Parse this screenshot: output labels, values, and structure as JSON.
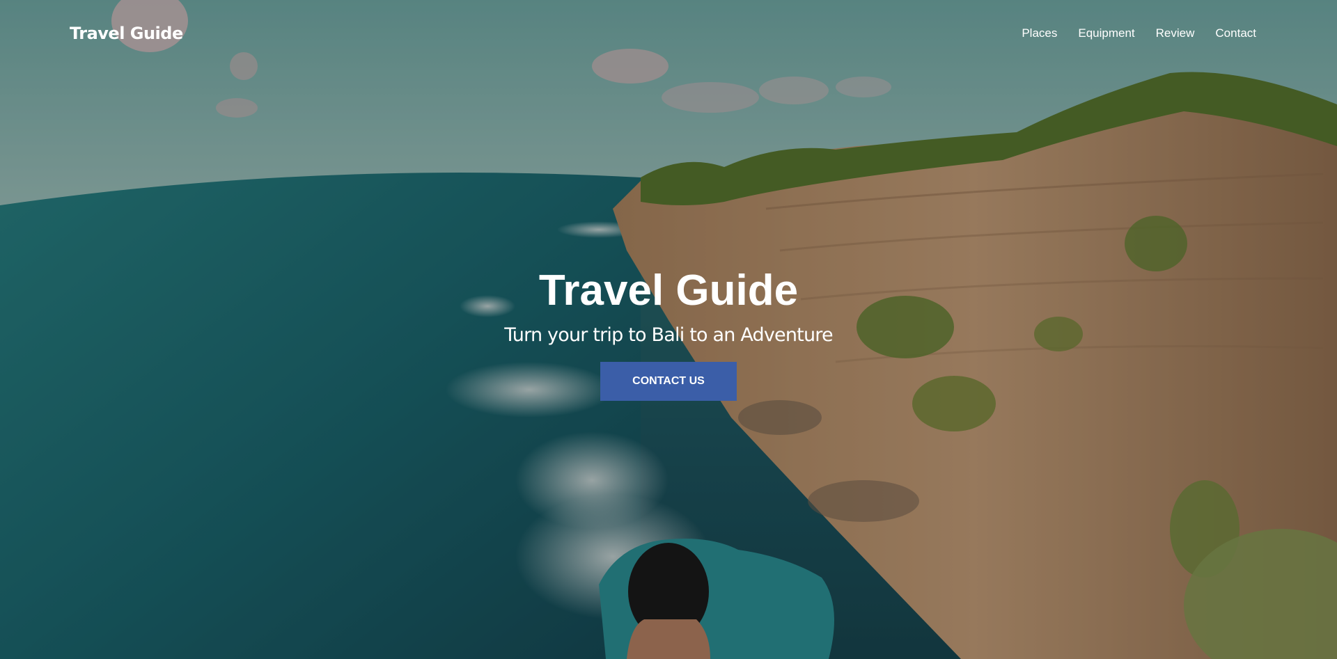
{
  "navbar": {
    "brand": "Travel Guide",
    "links": [
      "Places",
      "Equipment",
      "Review",
      "Contact"
    ]
  },
  "hero": {
    "title": "Travel Guide",
    "subtitle": "Turn your trip to Bali to an Adventure",
    "button_label": "CONTACT US"
  },
  "colors": {
    "button_bg": "#3b5ea8",
    "text": "#ffffff",
    "sea": "#1f6e74",
    "cliff": "#c9a27a",
    "vegetation": "#6f8a3a"
  }
}
